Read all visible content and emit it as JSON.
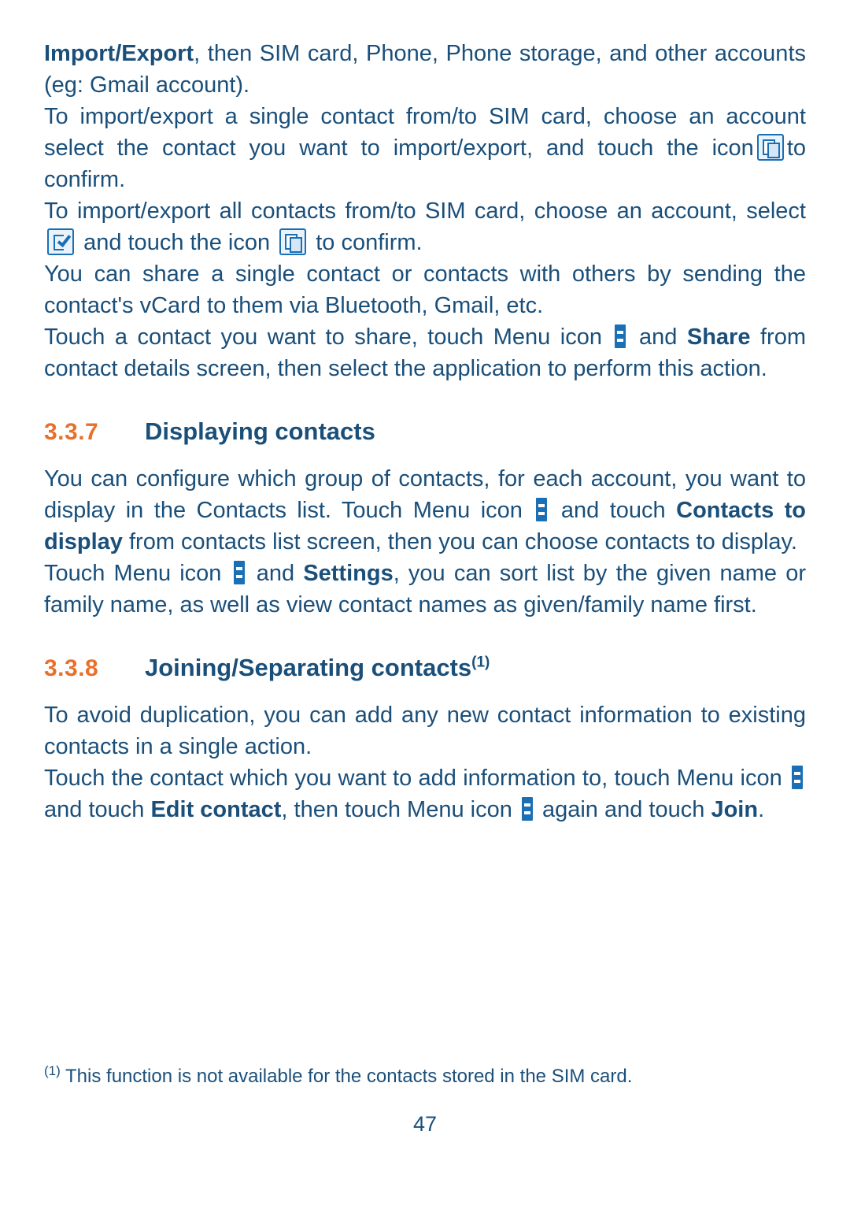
{
  "document": {
    "page_number": "47",
    "paragraphs": {
      "p1_bold": "Import/Export",
      "p1_rest": ", then SIM card, Phone, Phone storage, and other accounts (eg: Gmail account).",
      "p2_a": "To import/export a single contact from/to SIM card, choose an account select the contact you want to import/export, and touch the icon",
      "p2_b": "to confirm.",
      "p3_a": "To import/export all contacts from/to SIM card, choose an account, select",
      "p3_b": "and touch the icon",
      "p3_c": "to confirm.",
      "p4": "You can share a single contact or contacts with others by sending the contact's vCard to them via Bluetooth, Gmail, etc.",
      "p5_a": "Touch a contact you want to share, touch Menu icon",
      "p5_b": "and",
      "p5_bold": "Share",
      "p5_c": "from contact details screen, then select the application to perform this action.",
      "p6_a": "You can configure which group of contacts, for each account, you want to display in the Contacts list. Touch Menu icon",
      "p6_b": "and touch",
      "p6_bold1": "Contacts to display",
      "p6_c": "from contacts list screen, then you can choose contacts to display.",
      "p7_a": "Touch Menu icon",
      "p7_b": "and",
      "p7_bold": "Settings",
      "p7_c": ", you can sort list by the given name or family name, as well as view contact names as given/family name first.",
      "p8": "To avoid duplication, you can add any new contact information to existing contacts in a single action.",
      "p9_a": "Touch the contact which you want to add information to, touch Menu icon",
      "p9_b": "and touch",
      "p9_bold1": "Edit contact",
      "p9_c": ", then touch Menu icon",
      "p9_d": "again and touch",
      "p9_bold2": "Join",
      "p9_e": "."
    },
    "headings": [
      {
        "number": "3.3.7",
        "title": "Displaying contacts",
        "sup": ""
      },
      {
        "number": "3.3.8",
        "title": "Joining/Separating contacts",
        "sup": "(1)"
      }
    ],
    "footnote": {
      "mark": "(1)",
      "text": "This function is not available for the contacts stored in the SIM card."
    },
    "icons": {
      "copy": "copy-icon",
      "check": "checkbox-check-icon",
      "menu": "menu-overflow-icon"
    },
    "colors": {
      "text": "#1a4f7a",
      "accent": "#e8702a",
      "icon": "#1a6fb5"
    }
  }
}
